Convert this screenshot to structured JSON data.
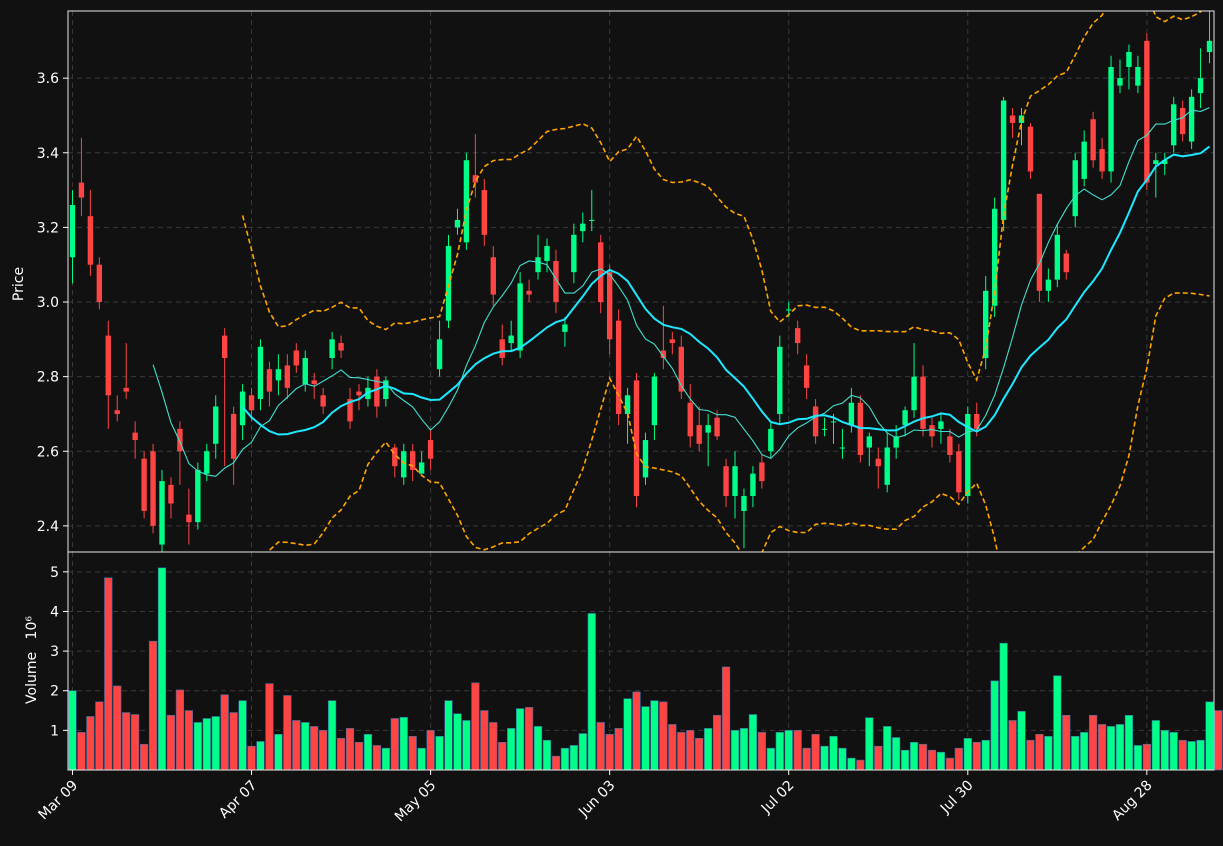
{
  "colors": {
    "background": "#111111",
    "up": "#00ff88",
    "down": "#ff4444",
    "grid": "#3a3a3a",
    "axis_text": "#ffffff",
    "ma_fast": "#40e0d0",
    "ma_slow": "#1ee8ff",
    "bollinger": "#ffa500"
  },
  "chart_data": {
    "type": "candlestick",
    "x_start": "2025-03-07",
    "x_step_days": 1,
    "x_ticks": [
      "Mar 09",
      "Apr 07",
      "May 05",
      "Jun 03",
      "Jul 02",
      "Jul 30",
      "Aug 28"
    ],
    "x_tick_index": [
      0,
      20,
      40,
      60,
      80,
      100,
      120
    ],
    "price_panel": {
      "ylabel": "Price",
      "ylim": [
        2.33,
        3.78
      ],
      "yticks": [
        2.4,
        2.6,
        2.8,
        3.0,
        3.2,
        3.4,
        3.6
      ],
      "grid": true
    },
    "volume_panel": {
      "ylabel": "Volume",
      "ylabel_exponent": "10⁶",
      "ylim": [
        0,
        5.5
      ],
      "yticks": [
        1,
        2,
        3,
        4,
        5
      ],
      "grid": true
    },
    "close": [
      3.26,
      3.28,
      3.1,
      3.0,
      2.75,
      2.7,
      2.76,
      2.63,
      2.44,
      2.4,
      2.52,
      2.46,
      2.6,
      2.41,
      2.55,
      2.6,
      2.72,
      2.85,
      2.58,
      2.76,
      2.71,
      2.88,
      2.76,
      2.82,
      2.77,
      2.83,
      2.85,
      2.78,
      2.72,
      2.9,
      2.87,
      2.68,
      2.75,
      2.77,
      2.72,
      2.79,
      2.56,
      2.6,
      2.55,
      2.57,
      2.58,
      2.9,
      3.15,
      3.22,
      3.38,
      3.32,
      3.18,
      3.02,
      2.85,
      2.91,
      3.05,
      3.02,
      3.12,
      3.15,
      3.0,
      2.94,
      3.18,
      3.21,
      3.22,
      3.0,
      2.9,
      2.7,
      2.75,
      2.48,
      2.63,
      2.8,
      2.85,
      2.89,
      2.76,
      2.64,
      2.62,
      2.67,
      2.64,
      2.48,
      2.56,
      2.48,
      2.54,
      2.52,
      2.66,
      2.88,
      2.98,
      2.89,
      2.77,
      2.64,
      2.66,
      2.68,
      2.61,
      2.73,
      2.59,
      2.64,
      2.56,
      2.61,
      2.64,
      2.71,
      2.8,
      2.66,
      2.64,
      2.68,
      2.59,
      2.49,
      2.7,
      2.66,
      3.03,
      3.25,
      3.54,
      3.48,
      3.5,
      3.35,
      3.03,
      3.06,
      3.18,
      3.08,
      3.38,
      3.43,
      3.38,
      3.35,
      3.63,
      3.6,
      3.67,
      3.63,
      3.32,
      3.38,
      3.38,
      3.53,
      3.45,
      3.55,
      3.6,
      3.7
    ],
    "open": [
      3.12,
      3.32,
      3.23,
      3.1,
      2.91,
      2.71,
      2.77,
      2.65,
      2.58,
      2.6,
      2.35,
      2.51,
      2.66,
      2.43,
      2.41,
      2.54,
      2.62,
      2.91,
      2.7,
      2.67,
      2.75,
      2.74,
      2.82,
      2.79,
      2.83,
      2.87,
      2.78,
      2.79,
      2.75,
      2.85,
      2.89,
      2.74,
      2.76,
      2.74,
      2.8,
      2.74,
      2.61,
      2.53,
      2.6,
      2.54,
      2.63,
      2.82,
      2.95,
      3.2,
      3.16,
      3.34,
      3.3,
      3.12,
      2.9,
      2.89,
      2.87,
      3.03,
      3.08,
      3.11,
      3.11,
      2.92,
      3.08,
      3.19,
      3.22,
      3.16,
      3.08,
      2.95,
      2.7,
      2.79,
      2.53,
      2.67,
      2.87,
      2.9,
      2.88,
      2.73,
      2.67,
      2.65,
      2.69,
      2.56,
      2.48,
      2.44,
      2.48,
      2.57,
      2.6,
      2.7,
      2.98,
      2.93,
      2.83,
      2.72,
      2.66,
      2.68,
      2.61,
      2.67,
      2.73,
      2.61,
      2.58,
      2.51,
      2.61,
      2.67,
      2.71,
      2.8,
      2.67,
      2.66,
      2.64,
      2.6,
      2.48,
      2.7,
      2.85,
      2.99,
      3.22,
      3.5,
      3.48,
      3.47,
      3.29,
      3.03,
      3.06,
      3.13,
      3.23,
      3.33,
      3.49,
      3.41,
      3.35,
      3.58,
      3.63,
      3.58,
      3.7,
      3.37,
      3.37,
      3.42,
      3.52,
      3.43,
      3.56,
      3.67
    ],
    "high": [
      3.3,
      3.44,
      3.3,
      3.12,
      2.95,
      2.75,
      2.89,
      2.68,
      2.6,
      2.62,
      2.55,
      2.53,
      2.68,
      2.5,
      2.57,
      2.62,
      2.75,
      2.93,
      2.72,
      2.78,
      2.77,
      2.9,
      2.84,
      2.86,
      2.86,
      2.89,
      2.87,
      2.81,
      2.77,
      2.92,
      2.91,
      2.77,
      2.78,
      2.8,
      2.82,
      2.8,
      2.62,
      2.62,
      2.62,
      2.6,
      2.66,
      2.95,
      3.18,
      3.25,
      3.4,
      3.45,
      3.33,
      3.15,
      2.94,
      2.95,
      3.08,
      3.06,
      3.18,
      3.17,
      3.14,
      2.96,
      3.21,
      3.24,
      3.3,
      3.18,
      3.1,
      2.98,
      2.77,
      2.81,
      2.65,
      2.81,
      2.99,
      2.92,
      2.91,
      2.78,
      2.72,
      2.7,
      2.71,
      2.58,
      2.6,
      2.5,
      2.56,
      2.59,
      2.68,
      2.91,
      3.0,
      2.95,
      2.86,
      2.74,
      2.69,
      2.7,
      2.66,
      2.77,
      2.75,
      2.65,
      2.61,
      2.65,
      2.67,
      2.72,
      2.89,
      2.83,
      2.69,
      2.7,
      2.66,
      2.62,
      2.72,
      2.73,
      3.07,
      3.28,
      3.55,
      3.52,
      3.52,
      3.48,
      3.07,
      3.09,
      3.21,
      3.14,
      3.4,
      3.46,
      3.51,
      3.44,
      3.66,
      3.65,
      3.69,
      3.66,
      3.72,
      3.4,
      3.4,
      3.55,
      3.54,
      3.57,
      3.68,
      3.78
    ],
    "low": [
      3.05,
      3.23,
      3.07,
      2.98,
      2.66,
      2.68,
      2.74,
      2.58,
      2.42,
      2.38,
      2.33,
      2.42,
      2.51,
      2.35,
      2.39,
      2.52,
      2.58,
      2.56,
      2.51,
      2.63,
      2.68,
      2.71,
      2.72,
      2.75,
      2.74,
      2.81,
      2.76,
      2.74,
      2.7,
      2.82,
      2.85,
      2.66,
      2.71,
      2.72,
      2.69,
      2.72,
      2.53,
      2.51,
      2.52,
      2.54,
      2.55,
      2.8,
      2.93,
      3.18,
      3.14,
      3.28,
      3.15,
      2.99,
      2.83,
      2.87,
      2.85,
      3.0,
      3.06,
      3.08,
      2.97,
      2.88,
      3.05,
      3.16,
      3.19,
      2.97,
      2.86,
      2.67,
      2.62,
      2.45,
      2.51,
      2.63,
      2.82,
      2.86,
      2.74,
      2.61,
      2.6,
      2.56,
      2.63,
      2.45,
      2.42,
      2.34,
      2.45,
      2.5,
      2.58,
      2.67,
      2.96,
      2.86,
      2.74,
      2.62,
      2.64,
      2.62,
      2.58,
      2.65,
      2.57,
      2.56,
      2.5,
      2.49,
      2.58,
      2.64,
      2.69,
      2.64,
      2.61,
      2.62,
      2.57,
      2.47,
      2.46,
      2.64,
      2.82,
      2.96,
      3.19,
      3.44,
      3.42,
      3.33,
      3.0,
      3.0,
      3.04,
      3.06,
      3.2,
      3.31,
      3.36,
      3.33,
      3.32,
      3.56,
      3.57,
      3.56,
      3.3,
      3.28,
      3.34,
      3.4,
      3.43,
      3.41,
      3.52,
      3.64
    ],
    "volume": [
      2.0,
      0.95,
      1.35,
      1.72,
      4.85,
      2.12,
      1.45,
      1.4,
      0.65,
      3.25,
      5.1,
      1.38,
      2.02,
      1.5,
      1.2,
      1.3,
      1.35,
      1.9,
      1.45,
      1.75,
      0.6,
      0.72,
      2.18,
      0.9,
      1.88,
      1.25,
      1.2,
      1.1,
      1.0,
      1.75,
      0.8,
      1.05,
      0.7,
      0.9,
      0.62,
      0.55,
      1.3,
      1.33,
      0.85,
      0.55,
      1.0,
      0.85,
      1.75,
      1.42,
      1.25,
      2.2,
      1.5,
      1.2,
      0.7,
      1.05,
      1.55,
      1.58,
      1.1,
      0.75,
      0.35,
      0.55,
      0.62,
      0.92,
      3.95,
      1.2,
      0.9,
      1.05,
      1.8,
      1.97,
      1.6,
      1.75,
      1.72,
      1.15,
      0.95,
      1.0,
      0.8,
      1.05,
      1.38,
      2.6,
      1.0,
      1.05,
      1.4,
      0.95,
      0.55,
      0.95,
      1.0,
      1.0,
      0.55,
      0.9,
      0.6,
      0.85,
      0.55,
      0.3,
      0.25,
      1.32,
      0.6,
      1.1,
      0.82,
      0.5,
      0.7,
      0.65,
      0.5,
      0.45,
      0.3,
      0.55,
      0.8,
      0.7,
      0.75,
      2.25,
      3.2,
      1.25,
      1.48,
      0.75,
      0.9,
      0.85,
      2.38,
      1.38,
      0.85,
      0.95,
      1.38,
      1.15,
      1.1,
      1.15,
      1.38,
      0.62,
      0.65,
      1.25,
      1.0,
      0.95,
      0.75,
      0.72,
      0.75,
      1.72,
      1.5
    ],
    "moving_averages": [
      {
        "type": "sma",
        "window": 10,
        "color": "#40e0d0"
      },
      {
        "type": "sma",
        "window": 20,
        "color": "#1ee8ff"
      }
    ],
    "bollinger": {
      "window": 20,
      "num_std": 2,
      "color": "#ffa500",
      "style": "dashed"
    }
  }
}
